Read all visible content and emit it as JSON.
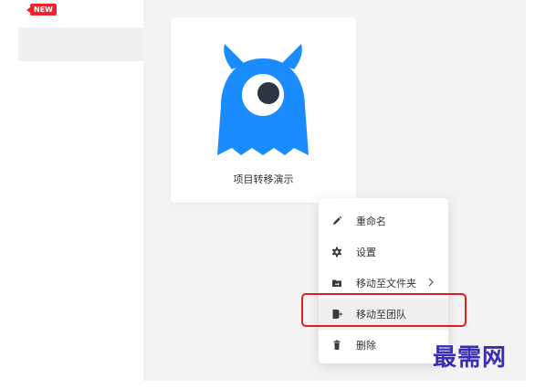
{
  "sidebar": {
    "new_badge": "NEW"
  },
  "project_card": {
    "title": "项目转移演示",
    "mascot_icon": "monster-mascot-icon",
    "mascot_color": "#1a8cff"
  },
  "context_menu": {
    "items": [
      {
        "label": "重命名",
        "icon": "pencil-icon"
      },
      {
        "label": "设置",
        "icon": "gear-icon"
      },
      {
        "label": "移动至文件夹",
        "icon": "folder-move-icon",
        "has_submenu": true
      },
      {
        "label": "移动至团队",
        "icon": "exit-icon",
        "hovered": true
      },
      {
        "label": "删除",
        "icon": "trash-icon"
      }
    ]
  },
  "annotation": {
    "highlight_color": "#e02020"
  },
  "watermark": {
    "text": "最需网"
  }
}
